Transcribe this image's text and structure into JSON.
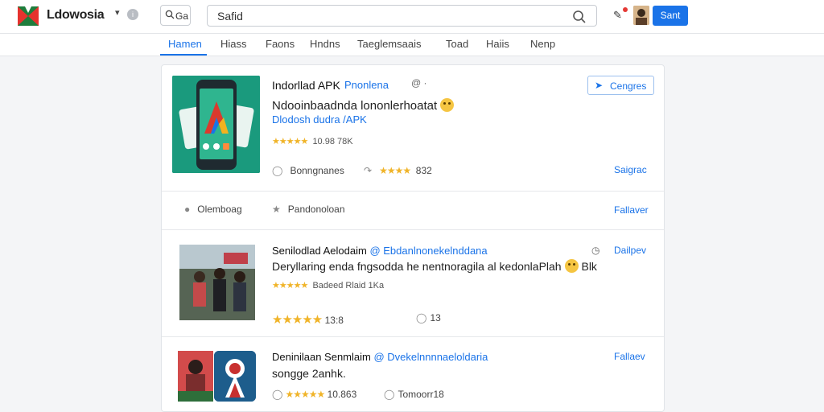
{
  "header": {
    "brand": "Ldowosia",
    "small_search_label": "Ga",
    "search_value": "Safid",
    "signin_label": "Sant"
  },
  "nav": {
    "tabs": [
      {
        "label": "Hamen"
      },
      {
        "label": "Hiass"
      },
      {
        "label": "Faons"
      },
      {
        "label": "Hndns"
      },
      {
        "label": "Taeglemsaais"
      },
      {
        "label": "Toad"
      },
      {
        "label": "Haiis"
      },
      {
        "label": "Nenp"
      }
    ]
  },
  "featured": {
    "title": "Indorllad APK",
    "title_link": "Pnonlena",
    "title_suffix": "@",
    "compare_label": "Cengres",
    "description": "Ndooinbaadnda lononlerhoatat",
    "subtitle": "Dlodosh dudra /APK",
    "rating_text": "10.98 78K",
    "meta_a": "Bonngnanes",
    "meta_b": "832",
    "side_link": "Saigrac"
  },
  "actions": {
    "a_label": "Olemboag",
    "b_label": "Pandonoloan",
    "side_link": "Fallaver"
  },
  "entries": [
    {
      "title": "Senilodlad Aelodaim",
      "title_link": "@ Ebdanlnonekelnddana",
      "line": "Deryllaring enda fngsodda he nentnoragila al kedonlaPlah",
      "line_suffix": "Blk",
      "small_text": "Badeed  Rlaid 1Ka",
      "meta_rating": "13:8",
      "meta_count": "13",
      "side_link": "Dailpev"
    },
    {
      "title": "Deninilaan Senmlaim",
      "title_link": "@ Dvekelnnnnaeloldaria",
      "line": "songge 2anhk.",
      "meta_rating": "10.863",
      "meta_count": "Tomoorr18",
      "side_link": "Fallaev"
    }
  ],
  "colors": {
    "accent": "#1a73e8",
    "star": "#f0b429",
    "hero_bg": "#1a9a7d"
  }
}
